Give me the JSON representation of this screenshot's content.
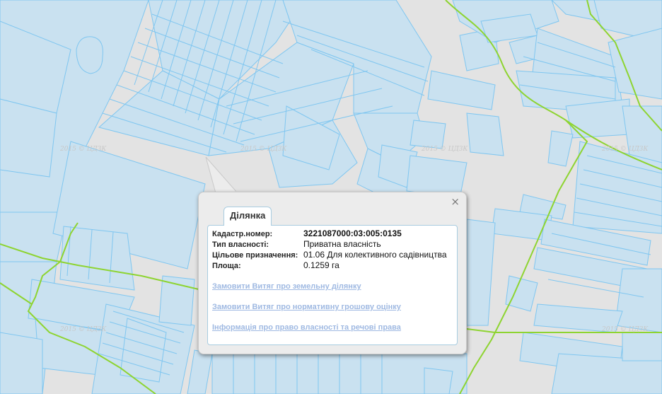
{
  "map": {
    "watermark": "2015 © ЦДЗК",
    "colors": {
      "background": "#e3e3e3",
      "parcel_fill": "#c9e1f0",
      "parcel_stroke": "#7fc6f0",
      "boundary": "#8ed431"
    }
  },
  "popup": {
    "tab_label": "Ділянка",
    "close_icon": "×",
    "fields": [
      {
        "label": "Кадастр.номер:",
        "value": "3221087000:03:005:0135"
      },
      {
        "label": "Тип власності:",
        "value": "Приватна власність"
      },
      {
        "label": "Цільове призначення:",
        "value": "01.06 Для колективного садівництва"
      },
      {
        "label": "Площа:",
        "value": "0.1259 га"
      }
    ],
    "links": [
      "Замовити Витяг про земельну ділянку",
      "Замовити Витяг про нормативну грошову оцінку",
      "Інформація про право власності та речові права"
    ]
  }
}
